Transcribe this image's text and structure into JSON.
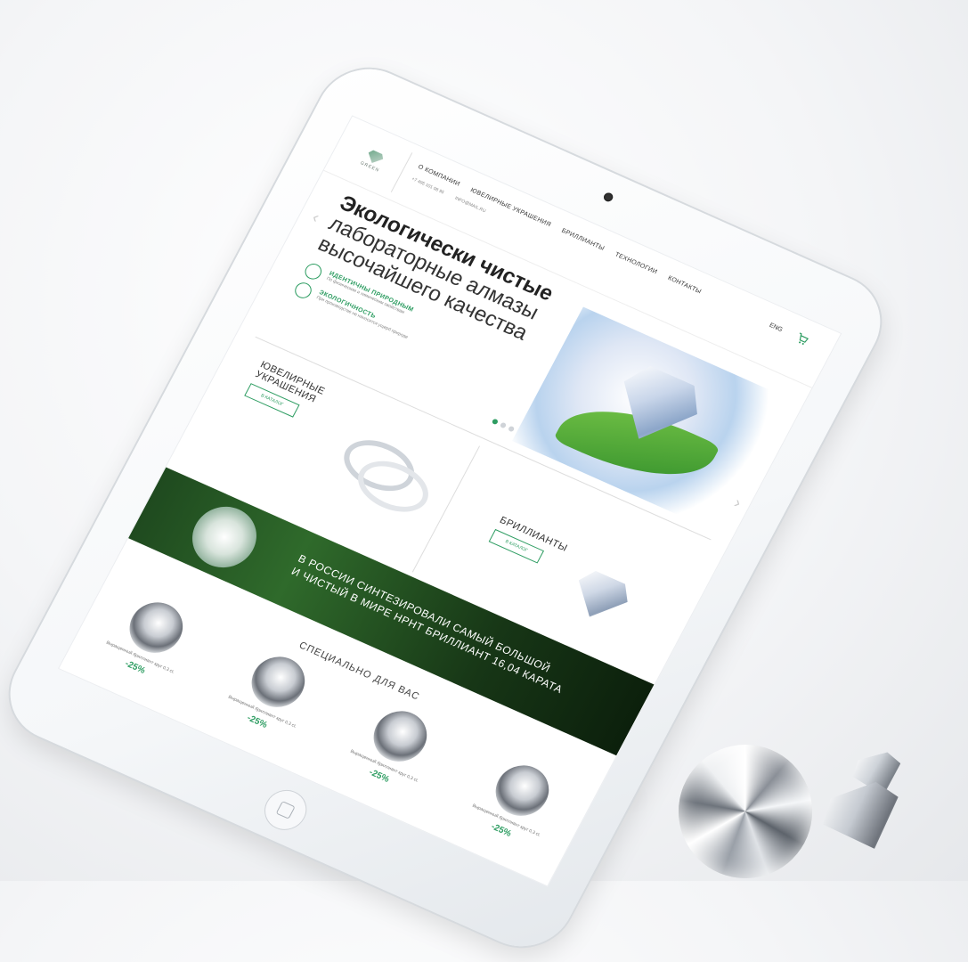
{
  "brand": {
    "logo_text": "GREEN"
  },
  "nav": {
    "items": [
      "О компании",
      "Ювелирные украшения",
      "Бриллианты",
      "Технологии",
      "Контакты"
    ],
    "phone": "+7 495 101 08 95",
    "email": "INFO@MAIL.RU",
    "lang": "ENG"
  },
  "hero": {
    "title_line1": "Экологически чистые",
    "title_line2": "лабораторные алмазы",
    "title_line3": "высочайшего качества",
    "features": [
      {
        "title": "ИДЕНТИЧНЫ ПРИРОДНЫМ",
        "desc": "По физическим и химическим свойствам"
      },
      {
        "title": "ЭКОЛОГИЧНОСТЬ",
        "desc": "При производстве не наносится ущерб природе"
      }
    ]
  },
  "categories": [
    {
      "name": "ЮВЕЛИРНЫЕ\nУКРАШЕНИЯ",
      "button": "В КАТАЛОГ"
    },
    {
      "name": "БРИЛЛИАНТЫ",
      "button": "В КАТАЛОГ"
    }
  ],
  "banner": {
    "text_line1": "В России синтезировали самый большой",
    "text_line2": "и чистый в мире HPHT бриллиант 16,04 карата"
  },
  "special": {
    "title": "СПЕЦИАЛЬНО ДЛЯ ВАС",
    "products": [
      {
        "name": "Выращенный бриллиант круг 0,3 ct.",
        "discount": "-25%"
      },
      {
        "name": "Выращенный бриллиант круг 0,3 ct.",
        "discount": "-25%"
      },
      {
        "name": "Выращенный бриллиант круг 0,3 ct.",
        "discount": "-25%"
      },
      {
        "name": "Выращенный бриллиант круг 0,3 ct.",
        "discount": "-25%"
      }
    ]
  },
  "colors": {
    "accent": "#2e9d62",
    "banner": "#1f4a1f"
  }
}
